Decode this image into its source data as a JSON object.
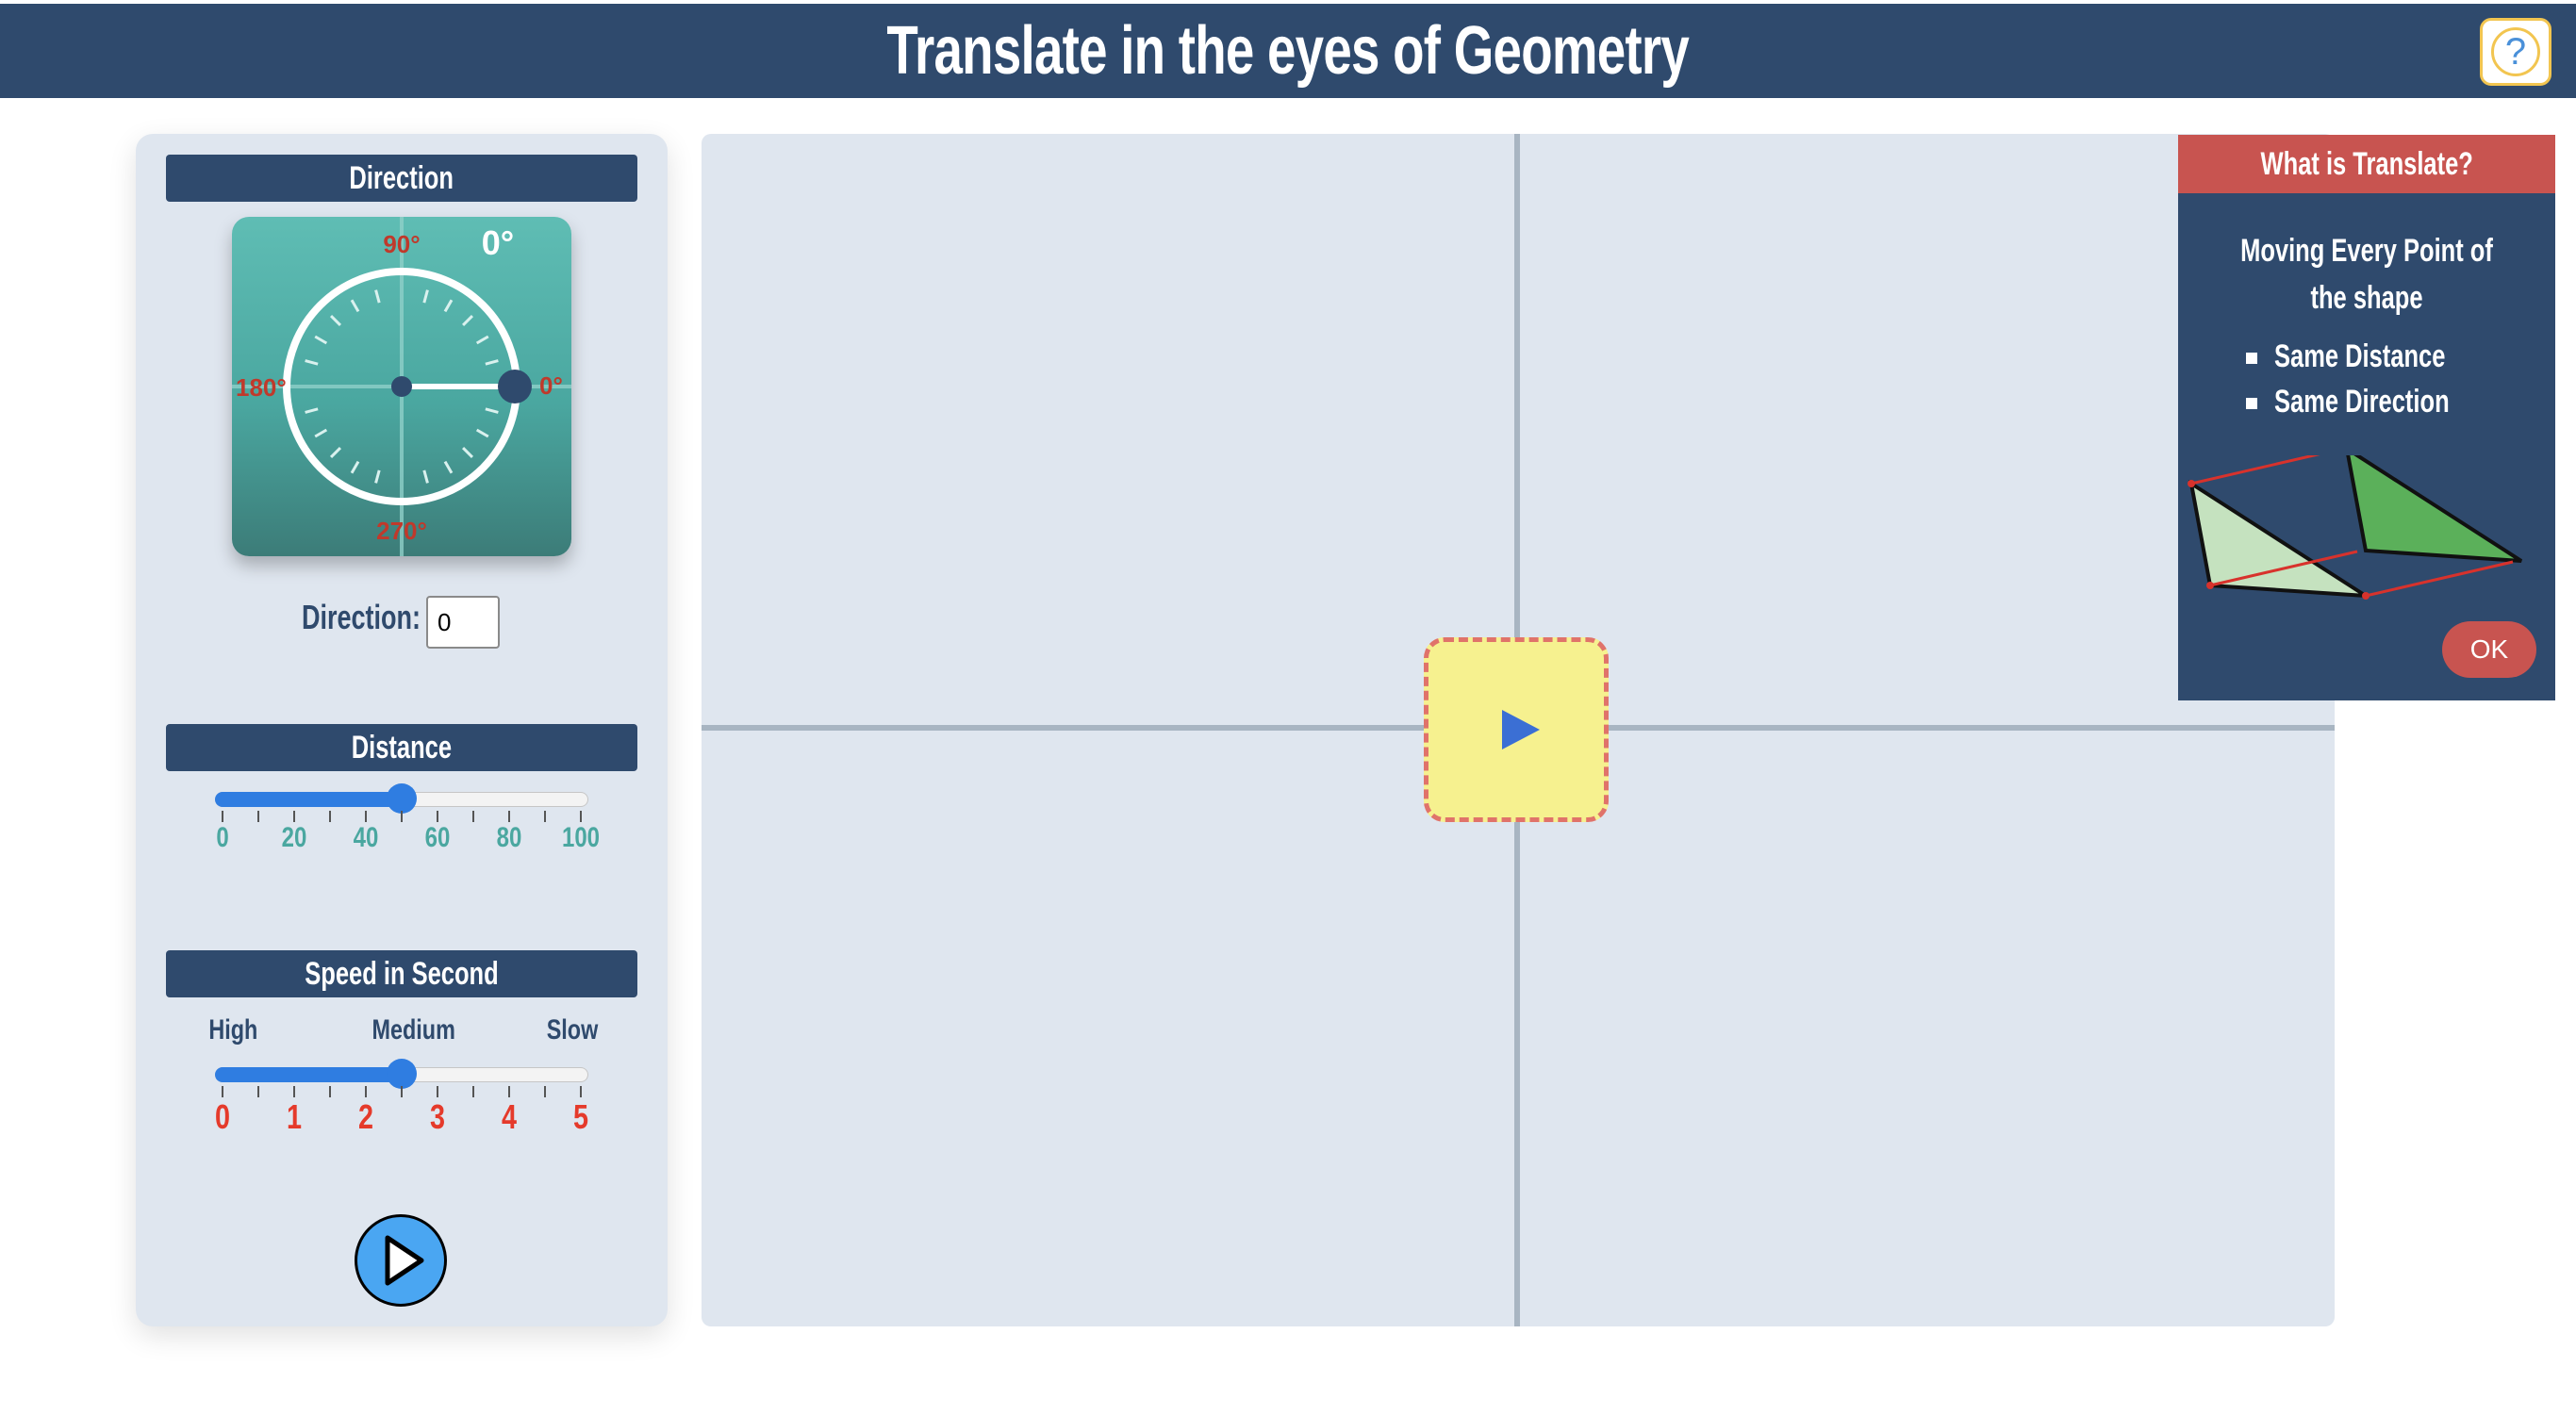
{
  "header": {
    "title": "Translate in the eyes of Geometry",
    "help_label": "?"
  },
  "colors": {
    "header_bg": "#2f4a6d",
    "panel_bg": "#dfe6ef",
    "dial_teal": "#4aa7a0",
    "accent_blue": "#2f7de1",
    "popup_red": "#c85450",
    "canvas_play_bg": "#f6f18f"
  },
  "controls": {
    "direction": {
      "title": "Direction",
      "dial_labels": {
        "top": "90°",
        "left": "180°",
        "right": "0°",
        "bottom": "270°"
      },
      "current_readout": "0°",
      "input_label": "Direction:",
      "input_value": "0"
    },
    "distance": {
      "title": "Distance",
      "tick_labels": [
        "0",
        "20",
        "40",
        "60",
        "80",
        "100"
      ],
      "value": 50,
      "min": 0,
      "max": 100
    },
    "speed": {
      "title": "Speed in Second",
      "word_labels": {
        "high": "High",
        "medium": "Medium",
        "slow": "Slow"
      },
      "tick_labels": [
        "0",
        "1",
        "2",
        "3",
        "4",
        "5"
      ],
      "value": 2.5,
      "min": 0,
      "max": 5
    },
    "play_icon": "play-icon"
  },
  "canvas": {
    "play_icon": "play-triangle-icon"
  },
  "info": {
    "title": "What is Translate?",
    "description": "Moving Every Point of the shape",
    "bullets": [
      "Same Distance",
      "Same Direction"
    ],
    "ok_label": "OK"
  }
}
